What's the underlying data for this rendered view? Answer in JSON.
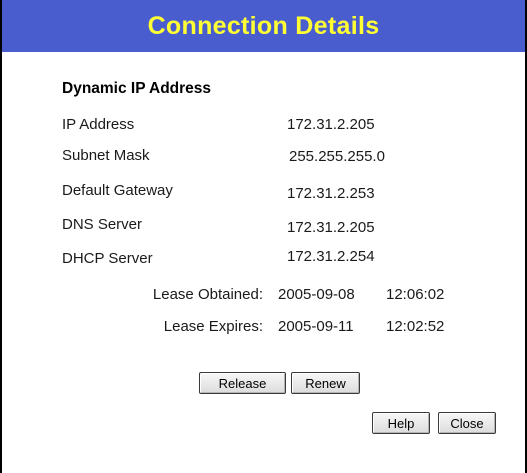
{
  "window": {
    "title": "Connection Details"
  },
  "connection": {
    "heading": "Dynamic IP Address",
    "rows": [
      {
        "label": "IP Address",
        "value": "172.31.2.205"
      },
      {
        "label": "Subnet Mask",
        "value": "255.255.255.0"
      },
      {
        "label": "Default Gateway",
        "value": "172.31.2.253"
      },
      {
        "label": "DNS Server",
        "value": "172.31.2.205"
      },
      {
        "label": "DHCP Server",
        "value": "172.31.2.254"
      }
    ],
    "lease": [
      {
        "label": "Lease Obtained:",
        "date": "2005-09-08",
        "time": "12:06:02"
      },
      {
        "label": "Lease Expires:",
        "date": "2005-09-11",
        "time": "12:02:52"
      }
    ]
  },
  "buttons": {
    "release": "Release",
    "renew": "Renew",
    "help": "Help",
    "close": "Close"
  },
  "colors": {
    "title_bar": "#4a5dcf",
    "title_text": "#ffff33"
  }
}
